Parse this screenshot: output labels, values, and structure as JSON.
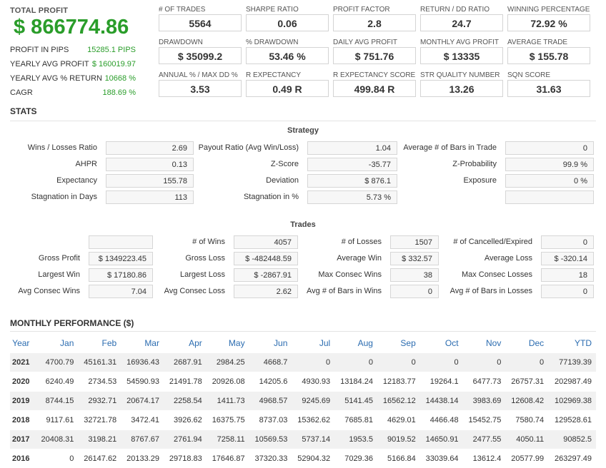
{
  "summary": {
    "total_profit_label": "TOTAL PROFIT",
    "total_profit_value": "$ 866774.86",
    "rows": [
      {
        "label": "PROFIT IN PIPS",
        "value": "15285.1 PIPS"
      },
      {
        "label": "YEARLY AVG PROFIT",
        "value": "$ 160019.97"
      },
      {
        "label": "YEARLY AVG % RETURN",
        "value": "10668 %"
      },
      {
        "label": "CAGR",
        "value": "188.69 %"
      }
    ]
  },
  "metrics": [
    {
      "label": "# OF TRADES",
      "value": "5564"
    },
    {
      "label": "SHARPE RATIO",
      "value": "0.06"
    },
    {
      "label": "PROFIT FACTOR",
      "value": "2.8"
    },
    {
      "label": "RETURN / DD RATIO",
      "value": "24.7"
    },
    {
      "label": "WINNING PERCENTAGE",
      "value": "72.92 %"
    },
    {
      "label": "DRAWDOWN",
      "value": "$ 35099.2"
    },
    {
      "label": "% DRAWDOWN",
      "value": "53.46 %"
    },
    {
      "label": "DAILY AVG PROFIT",
      "value": "$ 751.76"
    },
    {
      "label": "MONTHLY AVG PROFIT",
      "value": "$ 13335"
    },
    {
      "label": "AVERAGE TRADE",
      "value": "$ 155.78"
    },
    {
      "label": "ANNUAL % / MAX DD %",
      "value": "3.53"
    },
    {
      "label": "R EXPECTANCY",
      "value": "0.49 R"
    },
    {
      "label": "R EXPECTANCY SCORE",
      "value": "499.84 R"
    },
    {
      "label": "STR QUALITY NUMBER",
      "value": "13.26"
    },
    {
      "label": "SQN SCORE",
      "value": "31.63"
    }
  ],
  "stats": {
    "title": "STATS",
    "strategy_title": "Strategy",
    "strategy": [
      {
        "label": "Wins / Losses Ratio",
        "value": "2.69"
      },
      {
        "label": "Payout Ratio (Avg Win/Loss)",
        "value": "1.04"
      },
      {
        "label": "Average # of Bars in Trade",
        "value": "0"
      },
      {
        "label": "AHPR",
        "value": "0.13"
      },
      {
        "label": "Z-Score",
        "value": "-35.77"
      },
      {
        "label": "Z-Probability",
        "value": "99.9 %"
      },
      {
        "label": "Expectancy",
        "value": "155.78"
      },
      {
        "label": "Deviation",
        "value": "$ 876.1"
      },
      {
        "label": "Exposure",
        "value": "0 %"
      },
      {
        "label": "Stagnation in Days",
        "value": "113"
      },
      {
        "label": "Stagnation in %",
        "value": "5.73 %"
      },
      {
        "label": "",
        "value": ""
      }
    ],
    "trades_title": "Trades",
    "trades": [
      {
        "label": "",
        "value": ""
      },
      {
        "label": "# of Wins",
        "value": "4057"
      },
      {
        "label": "# of Losses",
        "value": "1507"
      },
      {
        "label": "# of Cancelled/Expired",
        "value": "0"
      },
      {
        "label": "Gross Profit",
        "value": "$ 1349223.45"
      },
      {
        "label": "Gross Loss",
        "value": "$ -482448.59"
      },
      {
        "label": "Average Win",
        "value": "$ 332.57"
      },
      {
        "label": "Average Loss",
        "value": "$ -320.14"
      },
      {
        "label": "Largest Win",
        "value": "$ 17180.86"
      },
      {
        "label": "Largest Loss",
        "value": "$ -2867.91"
      },
      {
        "label": "Max Consec Wins",
        "value": "38"
      },
      {
        "label": "Max Consec Losses",
        "value": "18"
      },
      {
        "label": "Avg Consec Wins",
        "value": "7.04"
      },
      {
        "label": "Avg Consec Loss",
        "value": "2.62"
      },
      {
        "label": "Avg # of Bars in Wins",
        "value": "0"
      },
      {
        "label": "Avg # of Bars in Losses",
        "value": "0"
      }
    ]
  },
  "monthly": {
    "title": "MONTHLY PERFORMANCE ($)",
    "headers": [
      "Year",
      "Jan",
      "Feb",
      "Mar",
      "Apr",
      "May",
      "Jun",
      "Jul",
      "Aug",
      "Sep",
      "Oct",
      "Nov",
      "Dec",
      "YTD"
    ],
    "rows": [
      [
        "2021",
        "4700.79",
        "45161.31",
        "16936.43",
        "2687.91",
        "2984.25",
        "4668.7",
        "0",
        "0",
        "0",
        "0",
        "0",
        "0",
        "77139.39"
      ],
      [
        "2020",
        "6240.49",
        "2734.53",
        "54590.93",
        "21491.78",
        "20926.08",
        "14205.6",
        "4930.93",
        "13184.24",
        "12183.77",
        "19264.1",
        "6477.73",
        "26757.31",
        "202987.49"
      ],
      [
        "2019",
        "8744.15",
        "2932.71",
        "20674.17",
        "2258.54",
        "1411.73",
        "4968.57",
        "9245.69",
        "5141.45",
        "16562.12",
        "14438.14",
        "3983.69",
        "12608.42",
        "102969.38"
      ],
      [
        "2018",
        "9117.61",
        "32721.78",
        "3472.41",
        "3926.62",
        "16375.75",
        "8737.03",
        "15362.62",
        "7685.81",
        "4629.01",
        "4466.48",
        "15452.75",
        "7580.74",
        "129528.61"
      ],
      [
        "2017",
        "20408.31",
        "3198.21",
        "8767.67",
        "2761.94",
        "7258.11",
        "10569.53",
        "5737.14",
        "1953.5",
        "9019.52",
        "14650.91",
        "2477.55",
        "4050.11",
        "90852.5"
      ],
      [
        "2016",
        "0",
        "26147.62",
        "20133.29",
        "29718.83",
        "17646.87",
        "37320.33",
        "52904.32",
        "7029.36",
        "5166.84",
        "33039.64",
        "13612.4",
        "20577.99",
        "263297.49"
      ]
    ]
  },
  "colors": {
    "profit_green": "#2a9d2a",
    "header_blue": "#2b6cb0"
  }
}
